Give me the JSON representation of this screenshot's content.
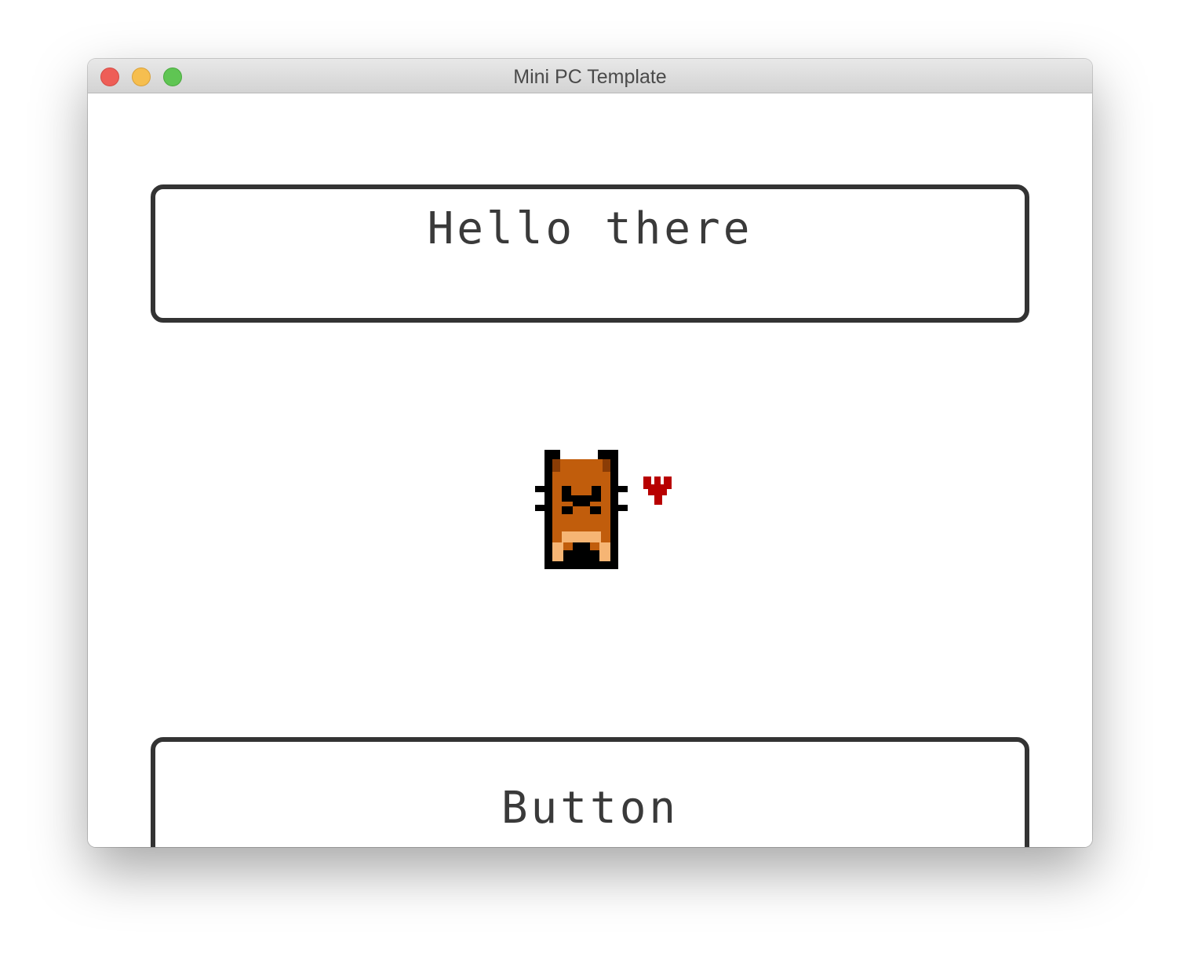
{
  "window": {
    "title": "Mini PC Template"
  },
  "dialog": {
    "text": "Hello there"
  },
  "action_button": {
    "label": "Button"
  },
  "sprite": {
    "character": "cat-character-icon",
    "emote": "heart-icon"
  },
  "colors": {
    "outline": "#333333",
    "fur": "#c15d0c",
    "fur_light": "#f6b574",
    "heart": "#b80000"
  }
}
